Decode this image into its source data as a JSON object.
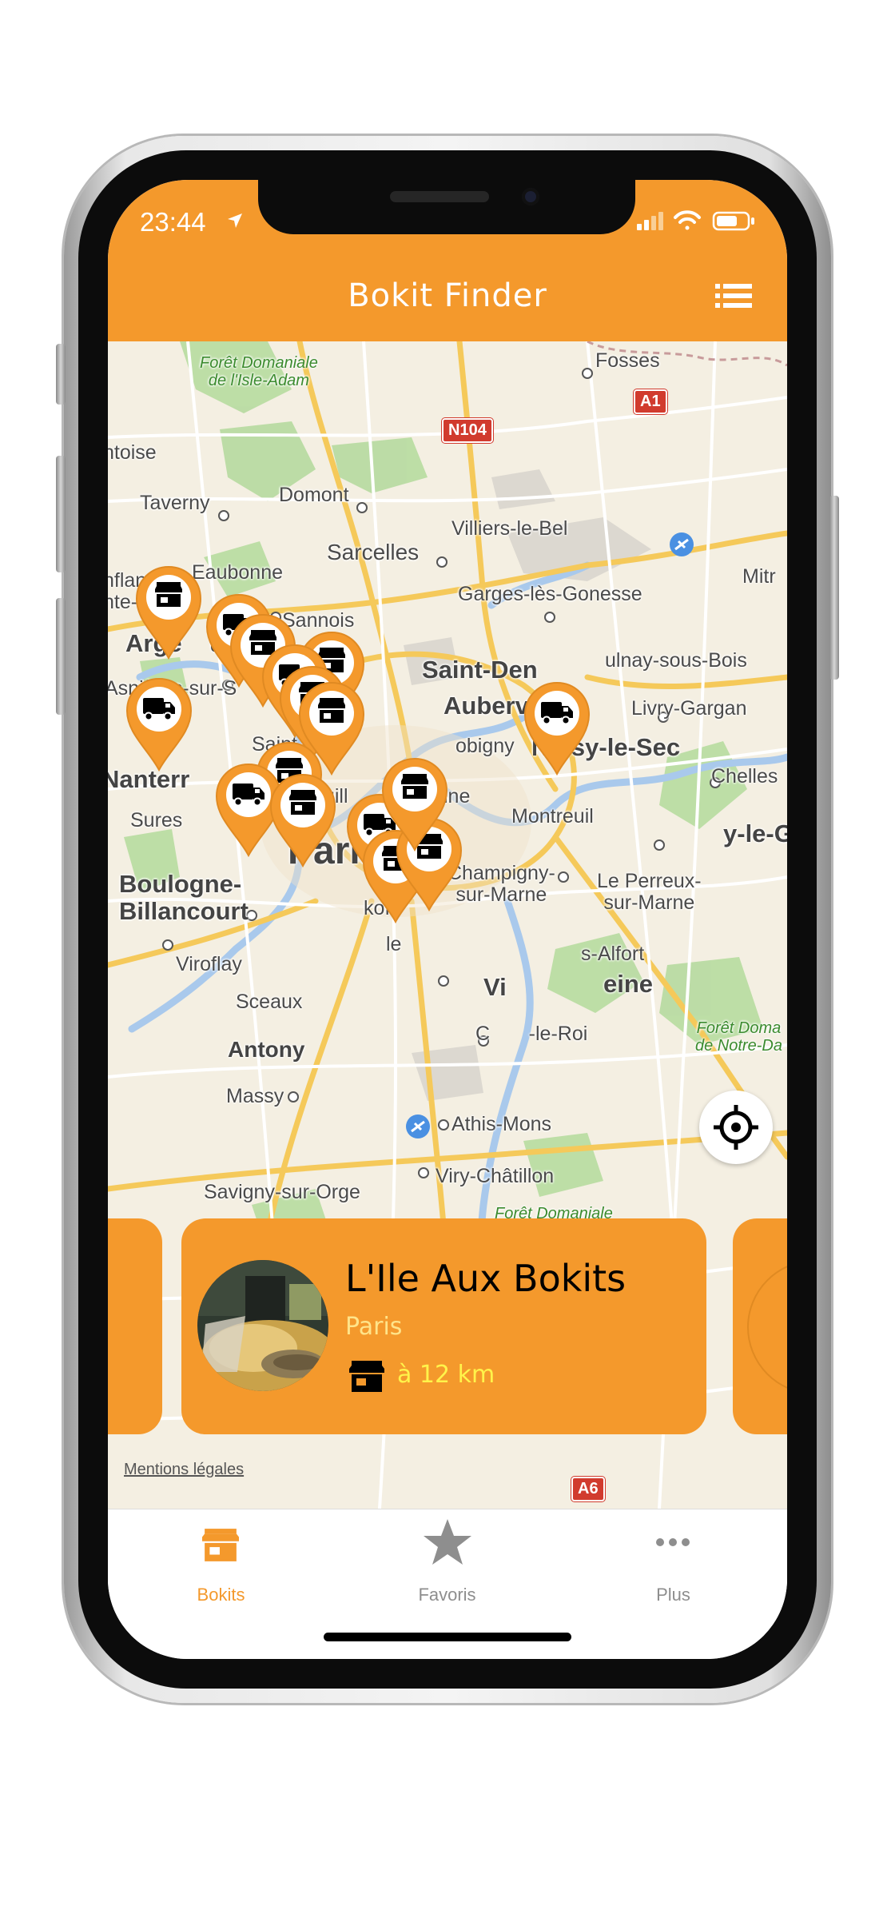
{
  "status_bar": {
    "time": "23:44"
  },
  "header": {
    "title": "Bokit Finder",
    "menu_icon": "list-icon"
  },
  "map": {
    "labels": {
      "foret_isle_adam": "Forêt Domaniale\nde l'Isle-Adam",
      "fosses": "Fosses",
      "pontoise": "ntoise",
      "taverny": "Taverny",
      "domont": "Domont",
      "villiers": "Villiers-le-Bel",
      "sarcelles": "Sarcelles",
      "mitry": "Mitr",
      "franconville": "nflans-\nnte-Ho",
      "eaubonne": "Eaubonne",
      "garges": "Garges-lès-Gonesse",
      "argenteuil": "Arge    uil",
      "sannois": "Sannois",
      "saint_denis": "Saint-Den",
      "aulnay": "ulnay-sous-Bois",
      "asnieres": "Asnières-sur-S",
      "aubervilliers": "Aubervill  s",
      "livry": "Livry-Gargan",
      "saint_ouen": "Saint-Ou",
      "bobigny": "obigny",
      "noisy_sec": "Noisy-le-Sec",
      "nanterre": "Nanterr",
      "chelles": "Chelles",
      "suresnes": "Sures",
      "neuilly": "Neuill",
      "pantin": "ine",
      "montreuil": "Montreuil",
      "noisy_grand": "y-le-G",
      "paris": "Paris",
      "boulogne": "Boulogne-\nBillancourt",
      "champigny": "Champigny-\nsur-Marne",
      "perreux": "Le Perreux-\nsur-Marne",
      "malakoff": "koff",
      "viroflay": "Viroflay",
      "alfort": "s-Alfort",
      "vitry": "Vi",
      "seine": "eine",
      "sceaux": "Sceaux",
      "choisy": "C       -le-Roi",
      "foret_notre_dame": "Forêt Doma\nde Notre-Da",
      "antony": "Antony",
      "massy": "Massy",
      "athis": "Athis-Mons",
      "viry": "Viry-Châtillon",
      "savigny": "Savigny-sur-Orge",
      "foret_domaniale": "Forêt Domaniale",
      "le": "le"
    },
    "roads": {
      "a1": "A1",
      "n104": "N104",
      "a6": "A6"
    },
    "pins": [
      {
        "type": "shop"
      },
      {
        "type": "truck"
      },
      {
        "type": "shop"
      },
      {
        "type": "shop"
      },
      {
        "type": "truck"
      },
      {
        "type": "truck"
      },
      {
        "type": "shop"
      },
      {
        "type": "shop"
      },
      {
        "type": "shop"
      },
      {
        "type": "truck"
      },
      {
        "type": "shop"
      },
      {
        "type": "shop"
      },
      {
        "type": "truck"
      },
      {
        "type": "shop"
      },
      {
        "type": "shop"
      },
      {
        "type": "shop"
      },
      {
        "type": "truck"
      }
    ],
    "legal_link": "Mentions légales"
  },
  "selected_card": {
    "title": "L'Ile Aux Bokits",
    "city": "Paris",
    "distance": "à 12 km",
    "type_icon": "shop-icon"
  },
  "tabs": [
    {
      "label": "Bokits",
      "icon": "shop-icon",
      "active": true
    },
    {
      "label": "Favoris",
      "icon": "star-icon",
      "active": false
    },
    {
      "label": "Plus",
      "icon": "more-icon",
      "active": false
    }
  ],
  "colors": {
    "accent": "#F4992C",
    "distance": "#FFF34A",
    "inactive_tab": "#8e8e8e"
  }
}
